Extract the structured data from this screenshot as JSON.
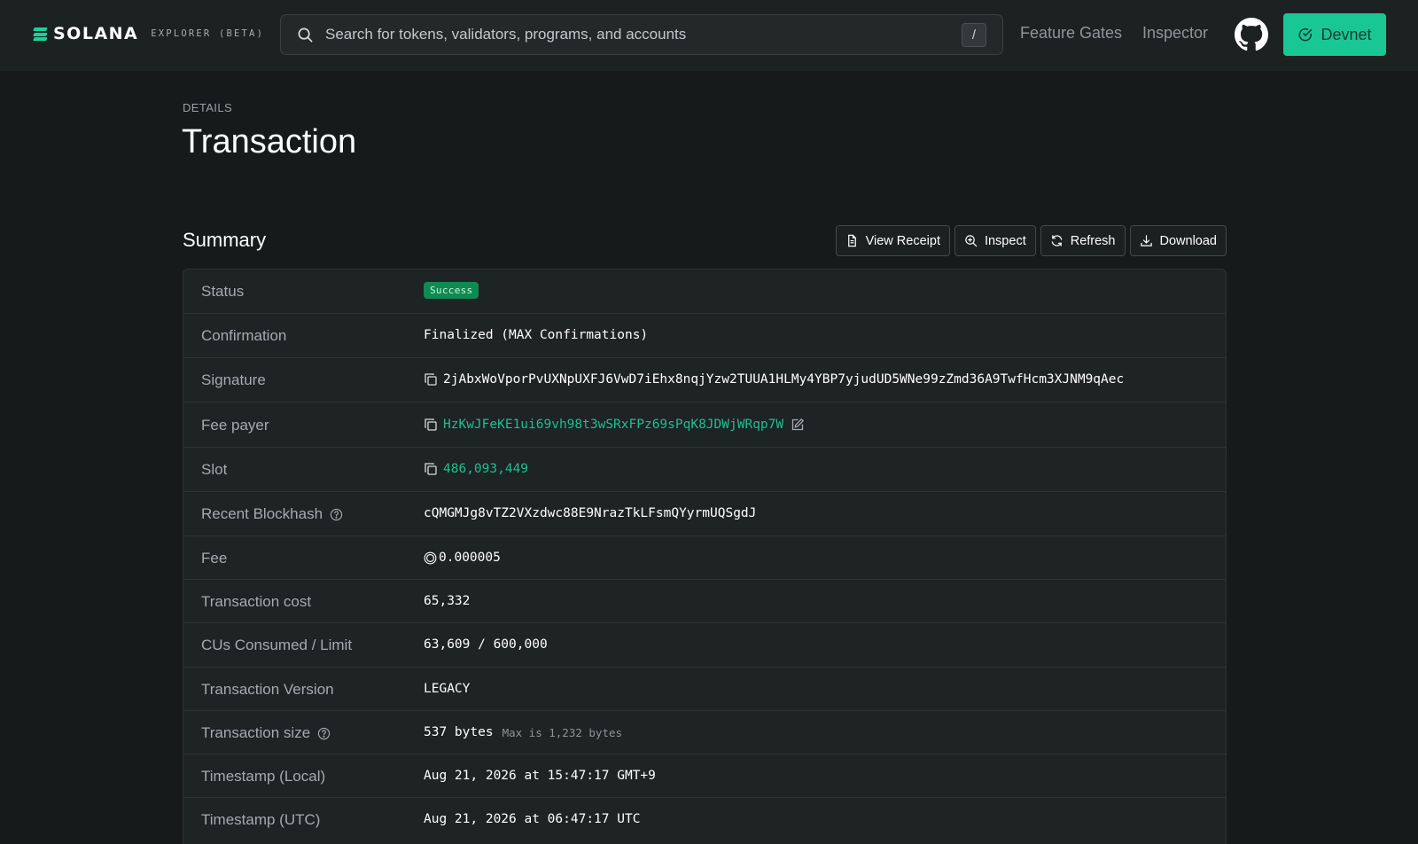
{
  "navbar": {
    "brand_word": "SOLANA",
    "brand_sub": "EXPLORER (BETA)",
    "search_placeholder": "Search for tokens, validators, programs, and accounts",
    "search_shortcut": "/",
    "links": [
      "Feature Gates",
      "Inspector"
    ],
    "cluster_button": "Devnet",
    "accent_color": "#19c794"
  },
  "header": {
    "pretitle": "DETAILS",
    "title": "Transaction"
  },
  "summary": {
    "title": "Summary",
    "buttons": {
      "view_receipt": "View Receipt",
      "inspect": "Inspect",
      "refresh": "Refresh",
      "download": "Download"
    },
    "rows": {
      "status": {
        "label": "Status",
        "value": "Success"
      },
      "confirmation": {
        "label": "Confirmation",
        "value": "Finalized (MAX Confirmations)"
      },
      "signature": {
        "label": "Signature",
        "value": "2jAbxWoVporPvUXNpUXFJ6VwD7iEhx8nqjYzw2TUUA1HLMy4YBP7yjudUD5WNe99zZmd36A9TwfHcm3XJNM9qAec"
      },
      "fee_payer": {
        "label": "Fee payer",
        "value": "HzKwJFeKE1ui69vh98t3wSRxFPz69sPqK8JDWjWRqp7W"
      },
      "slot": {
        "label": "Slot",
        "value": "486,093,449"
      },
      "recent_blockhash": {
        "label": "Recent Blockhash",
        "value": "cQMGMJg8vTZ2VXzdwc88E9NrazTkLFsmQYyrmUQSgdJ"
      },
      "fee": {
        "label": "Fee",
        "value": "0.000005"
      },
      "transaction_cost": {
        "label": "Transaction cost",
        "value": "65,332"
      },
      "cus": {
        "label": "CUs Consumed / Limit",
        "value": "63,609 / 600,000"
      },
      "version": {
        "label": "Transaction Version",
        "value": "LEGACY"
      },
      "size": {
        "label": "Transaction size",
        "value": "537 bytes",
        "note": "Max is 1,232 bytes"
      },
      "timestamp_local": {
        "label": "Timestamp (Local)",
        "value": "Aug 21, 2026 at 15:47:17 GMT+9"
      },
      "timestamp_utc": {
        "label": "Timestamp (UTC)",
        "value": "Aug 21, 2026 at 06:47:17 UTC"
      }
    },
    "status_color": "#0f8a52",
    "link_color": "#1fbf8f"
  }
}
